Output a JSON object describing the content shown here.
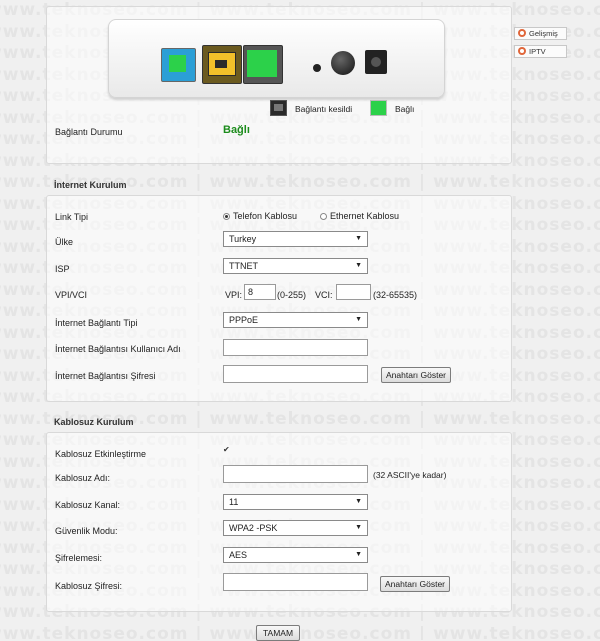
{
  "watermark": "www.teknoseo.com | www.teknoseo.com | www.teknoseo.com | www.teknoseo.com",
  "side_buttons": {
    "advanced": "Gelişmiş",
    "iptv": "IPTV"
  },
  "legend": {
    "disconnected": "Bağlantı kesildi",
    "connected": "Bağlı"
  },
  "status": {
    "label": "Bağlantı Durumu",
    "value": "Bağlı",
    "value_color": "#1c8c1c"
  },
  "internet": {
    "title": "İnternet Kurulum",
    "link_type_label": "Link Tipi",
    "link_options": [
      "Telefon Kablosu",
      "Ethernet Kablosu"
    ],
    "link_selected": "Telefon Kablosu",
    "country_label": "Ülke",
    "country_value": "Turkey",
    "isp_label": "ISP",
    "isp_value": "TTNET",
    "vpivci_label": "VPI/VCI",
    "vpi_label": "VPI:",
    "vpi_value": "8",
    "vpi_range": "(0-255)",
    "vci_label": "VCI:",
    "vci_value": "",
    "vci_range": "(32-65535)",
    "conn_type_label": "İnternet Bağlantı Tipi",
    "conn_type_value": "PPPoE",
    "username_label": "İnternet Bağlantısı Kullanıcı Adı",
    "username_value": "",
    "password_label": "İnternet Bağlantısı Şifresi",
    "password_value": "",
    "show_key": "Anahtarı Göster"
  },
  "wireless": {
    "title": "Kablosuz Kurulum",
    "enable_label": "Kablosuz Etkinleştirme",
    "enable_checked": true,
    "ssid_label": "Kablosuz Adı:",
    "ssid_value": "",
    "ssid_hint": "(32 ASCII'ye kadar)",
    "channel_label": "Kablosuz Kanal:",
    "channel_value": "11",
    "security_label": "Güvenlik Modu:",
    "security_value": "WPA2 -PSK",
    "encryption_label": "Şifrelemesi:",
    "encryption_value": "AES",
    "password_label": "Kablosuz Şifresi:",
    "password_value": "",
    "show_key": "Anahtarı Göster"
  },
  "ok_button": "TAMAM",
  "arrow_glyph": "▼",
  "check_glyph": "✔"
}
